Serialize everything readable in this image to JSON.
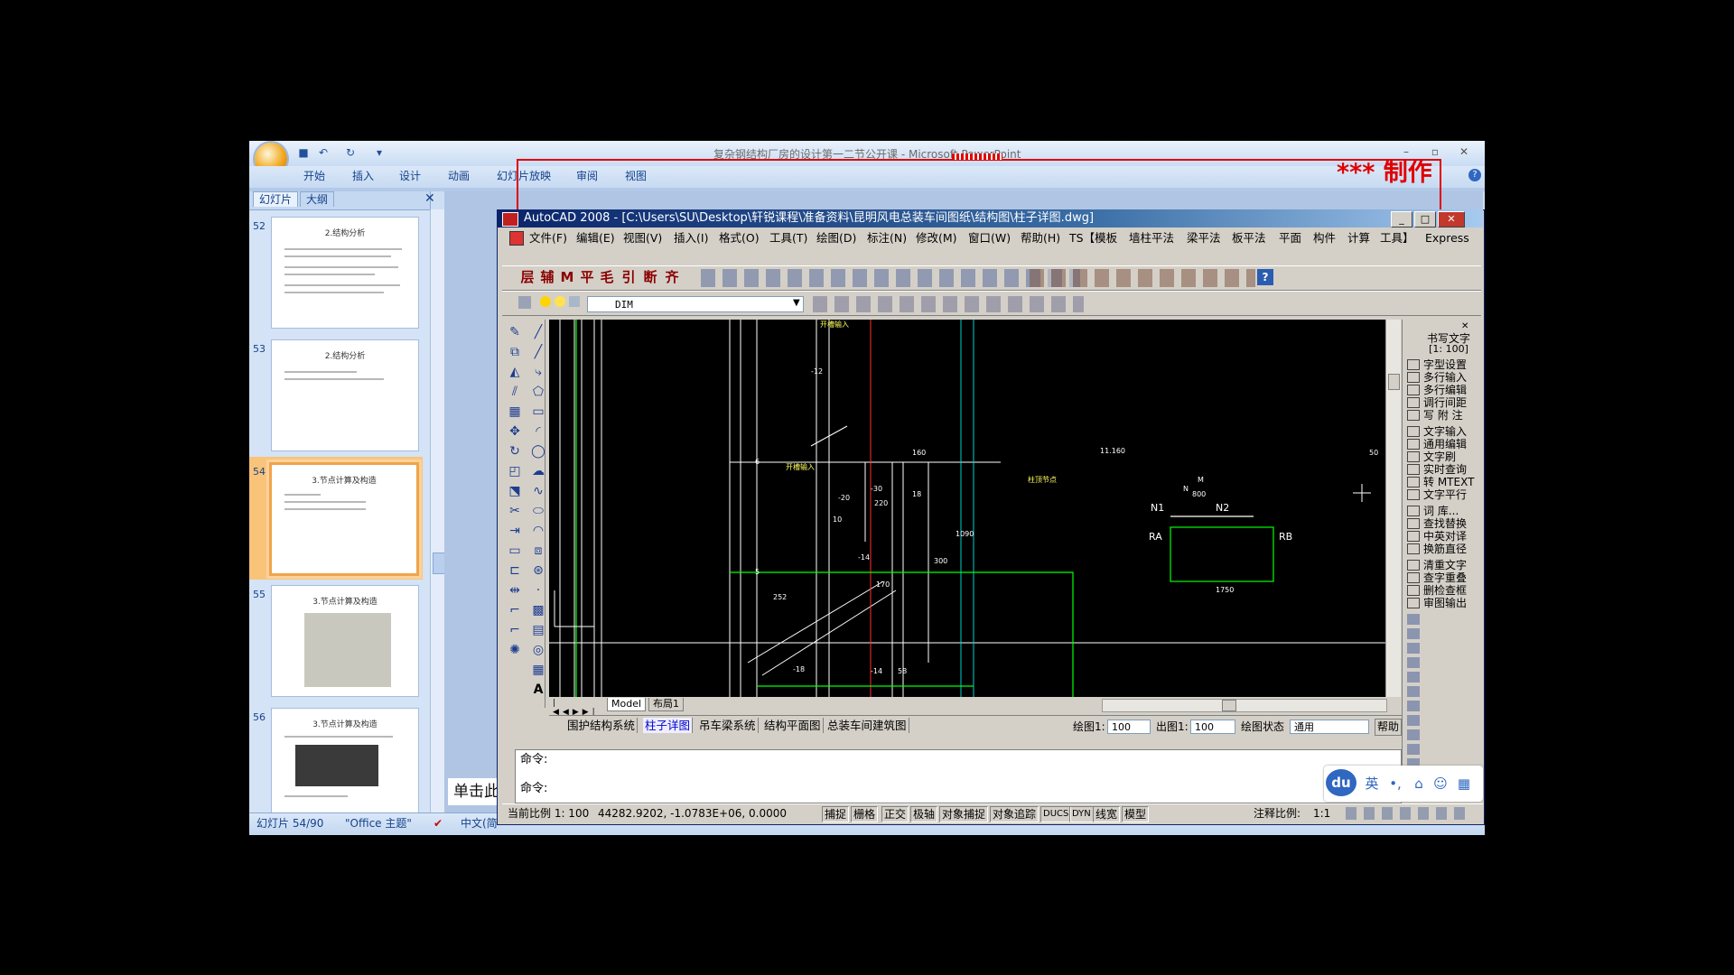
{
  "ppt": {
    "title": "复杂钢结构厂房的设计第一二节公开课 - Microsoft PowerPoint",
    "ribbon_tabs": [
      "开始",
      "插入",
      "设计",
      "动画",
      "幻灯片放映",
      "审阅",
      "视图"
    ],
    "pane_tabs": [
      "幻灯片",
      "大纲"
    ],
    "slides": [
      {
        "num": "52",
        "title": "2.结构分析"
      },
      {
        "num": "53",
        "title": "2.结构分析"
      },
      {
        "num": "54",
        "title": "3.节点计算及构造"
      },
      {
        "num": "55",
        "title": "3.节点计算及构造"
      },
      {
        "num": "56",
        "title": "3.节点计算及构造"
      }
    ],
    "slide_edit_text": "单击此",
    "status": {
      "slide": "幻灯片 54/90",
      "theme": "\"Office 主题\"",
      "lang": "中文(简"
    }
  },
  "banner": "*** 制作",
  "cad": {
    "title": "AutoCAD 2008 - [C:\\Users\\SU\\Desktop\\轩锐课程\\准备资料\\昆明风电总装车间图纸\\结构图\\柱子详图.dwg]",
    "menu": [
      "文件(F)",
      "编辑(E)",
      "视图(V)",
      "插入(I)",
      "格式(O)",
      "工具(T)",
      "绘图(D)",
      "标注(N)",
      "修改(M)",
      "窗口(W)",
      "帮助(H)",
      "TS【模板",
      "墙柱平法",
      "梁平法",
      "板平法",
      "平面",
      "构件",
      "计算",
      "工具】",
      "Express"
    ],
    "tb_glyphs": [
      "层",
      "辅",
      "M",
      "平",
      "毛",
      "引",
      "断",
      "齐"
    ],
    "layer": "DIM",
    "model_tabs": [
      "Model",
      "布局1"
    ],
    "right_panel": {
      "header": "书写文字",
      "scale": "[1: 100]",
      "items": [
        "字型设置",
        "多行输入",
        "多行编辑",
        "调行间距",
        "写 附 注",
        "文字输入",
        "通用编辑",
        "文字刷",
        "实时查询",
        "转 MTEXT",
        "文字平行",
        "词  库...",
        "查找替换",
        "中英对译",
        "换筋直径",
        "清重文字",
        "查字重叠",
        "删检查框",
        "审图输出"
      ]
    },
    "sheet_tabs": [
      "围护结构系统",
      "柱子详图",
      "吊车梁系统",
      "结构平面图",
      "总装车间建筑图"
    ],
    "sheet_right": {
      "draw_label": "绘图1:",
      "draw_val": "100",
      "out_label": "出图1:",
      "out_val": "100",
      "state_label": "绘图状态",
      "state_val": "通用",
      "help": "帮助"
    },
    "cmd_lines": [
      "命令:",
      "命令:"
    ],
    "status": {
      "scale": "当前比例 1: 100",
      "coords": "44282.9202, -1.0783E+06, 0.0000",
      "buttons": [
        "捕捉",
        "栅格",
        "正交",
        "极轴",
        "对象捕捉",
        "对象追踪",
        "DUCS",
        "DYN",
        "线宽",
        "模型"
      ],
      "anno": "注释比例:",
      "anno_val": "1:1"
    }
  },
  "drawing_labels": {
    "a": "开槽输入",
    "b": "-12",
    "c": "6",
    "d": "5",
    "e": "11.160",
    "f": "柱顶节点",
    "g": "N1",
    "h": "N2",
    "i": "M",
    "j": "N",
    "k": "RA",
    "l": "RB",
    "m": "1750",
    "n": "800",
    "o": "-20",
    "p": "220",
    "q": "-30",
    "r": "18",
    "s": "10",
    "t": "-14",
    "u": "170",
    "v": "252",
    "w": "-18",
    "x": "-14",
    "y": "58",
    "z": "160",
    "aa": "300",
    "ab": "1090",
    "ac": "50",
    "ad": "开槽输入"
  },
  "ime": {
    "logo": "du",
    "lang": "英"
  },
  "colors": {
    "autocad_title": "#0a246a",
    "accent_red": "#e00000",
    "drawing_bg": "#000000"
  }
}
